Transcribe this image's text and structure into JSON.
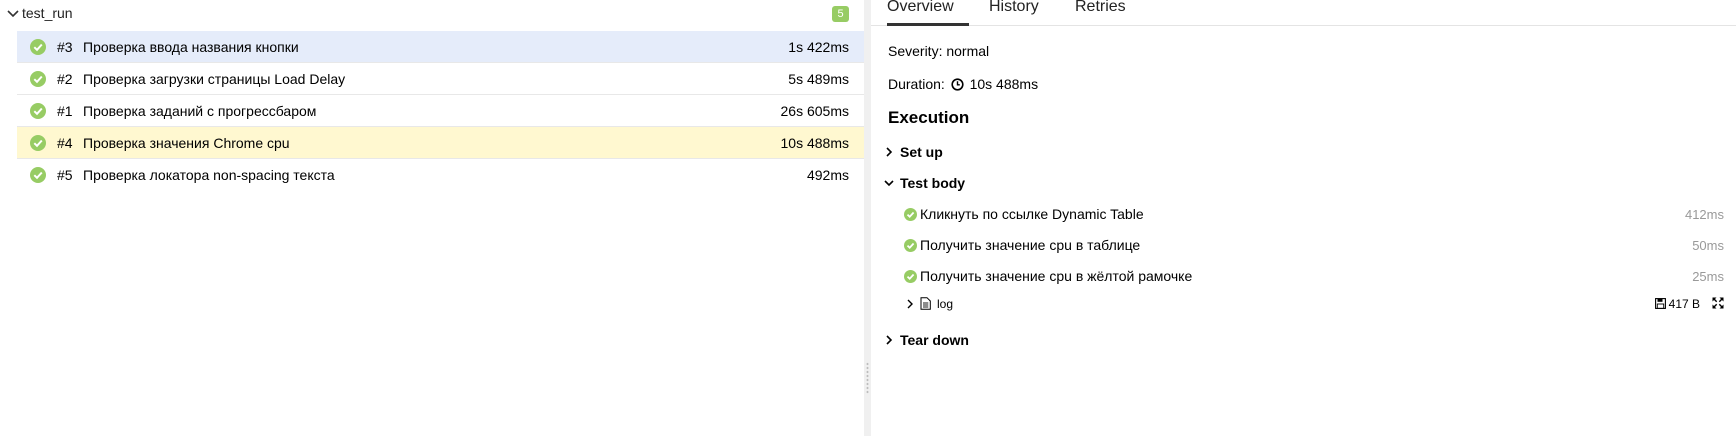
{
  "tree": {
    "group_title": "test_run",
    "count": "5",
    "rows": [
      {
        "num": "#3",
        "name": "Проверка ввода названия кнопки",
        "duration": "1s 422ms"
      },
      {
        "num": "#2",
        "name": "Проверка загрузки страницы Load Delay",
        "duration": "5s 489ms"
      },
      {
        "num": "#1",
        "name": "Проверка заданий с прогрессбаром",
        "duration": "26s 605ms"
      },
      {
        "num": "#4",
        "name": "Проверка значения Chrome cpu",
        "duration": "10s 488ms"
      },
      {
        "num": "#5",
        "name": "Проверка локатора non-spacing текста",
        "duration": "492ms"
      }
    ]
  },
  "details": {
    "tabs": [
      "Overview",
      "History",
      "Retries"
    ],
    "severity_label": "Severity:",
    "severity_value": "normal",
    "duration_label": "Duration:",
    "duration_value": "10s 488ms",
    "execution_title": "Execution",
    "setup_label": "Set up",
    "test_body_label": "Test body",
    "teardown_label": "Tear down",
    "steps": [
      {
        "name": "Кликнуть по ссылке Dynamic Table",
        "duration": "412ms"
      },
      {
        "name": "Получить значение cpu в таблице",
        "duration": "50ms"
      },
      {
        "name": "Получить значение cpu в жёлтой рамочке",
        "duration": "25ms"
      }
    ],
    "attachment": {
      "name": "log",
      "size": "417 B"
    }
  },
  "colors": {
    "passed": "#97cc64",
    "selected_row": "#e5ecfa",
    "highlighted_row": "#fff8d0"
  }
}
